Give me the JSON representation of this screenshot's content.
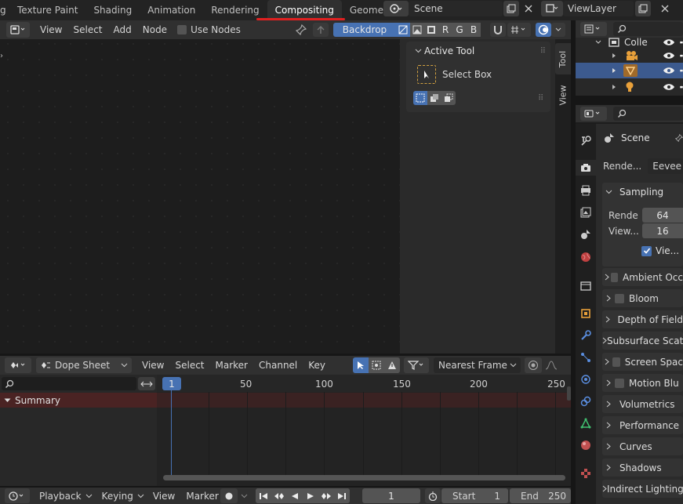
{
  "workspace_tabs": [
    "g",
    "Texture Paint",
    "Shading",
    "Animation",
    "Rendering",
    "Compositing",
    "Geometry Nodes"
  ],
  "active_workspace": "Compositing",
  "scene_selector": {
    "value": "Scene"
  },
  "viewlayer_selector": {
    "value": "ViewLayer"
  },
  "node_editor": {
    "menu": [
      "View",
      "Select",
      "Add",
      "Node"
    ],
    "use_nodes_label": "Use Nodes",
    "backdrop_label": "Backdrop",
    "channel_buttons": [
      "R",
      "G",
      "B"
    ]
  },
  "sidebar": {
    "tabs": [
      "Tool",
      "View"
    ],
    "active_tool_title": "Active Tool",
    "select_box_label": "Select Box"
  },
  "dope_sheet": {
    "mode": "Dope Sheet",
    "menu": [
      "View",
      "Select",
      "Marker",
      "Channel",
      "Key"
    ],
    "snap_mode": "Nearest Frame",
    "summary_label": "Summary",
    "current_frame_badge": "1",
    "ruler_ticks": [
      "50",
      "100",
      "150",
      "200",
      "250"
    ]
  },
  "timeline": {
    "menu": [
      "Playback",
      "Keying",
      "View",
      "Marker"
    ],
    "current_frame": "1",
    "start_label": "Start",
    "start_value": "1",
    "end_label": "End",
    "end_value": "250"
  },
  "outliner": {
    "collection_label": "Colle"
  },
  "properties": {
    "scene_label": "Scene",
    "render_engine_label": "Rende...",
    "render_engine_value": "Eevee",
    "sampling": {
      "title": "Sampling",
      "render_label": "Rende",
      "render_value": "64",
      "viewport_label": "View...",
      "viewport_value": "16",
      "viewport_denoise_label": "Vie..."
    },
    "panels": [
      "Ambient Occ",
      "Bloom",
      "Depth of Field",
      "Subsurface Scat",
      "Screen Spac",
      "Motion Blu",
      "Volumetrics",
      "Performance",
      "Curves",
      "Shadows",
      "Indirect Lighting"
    ],
    "panels_with_checkbox": [
      true,
      true,
      false,
      false,
      true,
      true,
      false,
      false,
      false,
      false,
      false
    ]
  },
  "colors": {
    "accent_blue": "#4772b3",
    "active_tab_underline": "#e02020",
    "summary_row": "#4a2323"
  }
}
